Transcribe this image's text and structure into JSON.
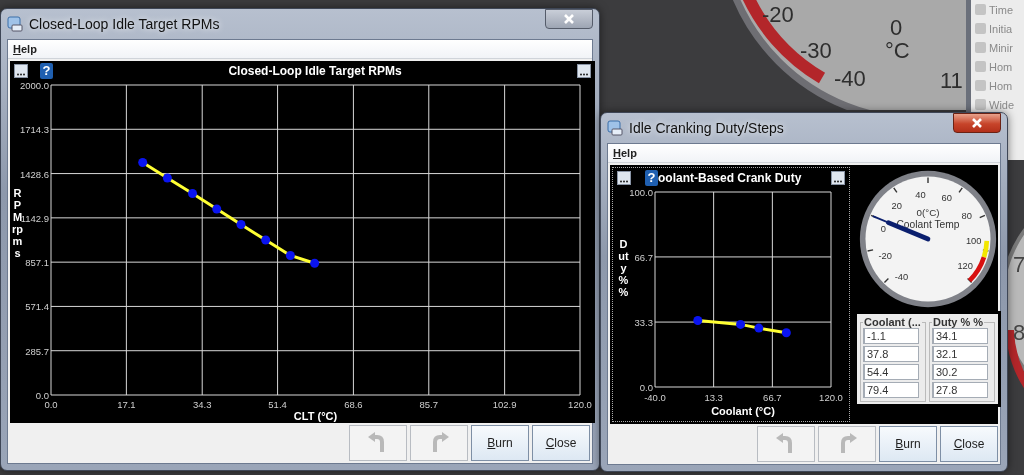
{
  "desktop": {
    "gauge_labels": [
      "-20",
      "-30",
      "-40",
      "0",
      "°C",
      "11"
    ],
    "side_list": [
      "Time",
      "Initia",
      "Minir",
      "Hom",
      "Hom",
      "Wide"
    ],
    "edge_labels": [
      "7",
      "8"
    ]
  },
  "windows": [
    {
      "kind": "curve",
      "title": "Closed-Loop Idle Target RPMs",
      "active": false,
      "menu": [
        "Help"
      ],
      "help_badge": "?",
      "chart_data": {
        "type": "line",
        "title": "Closed-Loop Idle Target RPMs",
        "xlabel": "CLT (°C)",
        "ylabel": "RPM rpms",
        "x": [
          20.8,
          26.4,
          32.1,
          37.6,
          43.1,
          48.7,
          54.3,
          59.8
        ],
        "series": [
          {
            "color": "#ffff33",
            "marker": "circle",
            "values": [
              1500,
              1400,
              1300,
              1200,
              1100,
              1000,
              900,
              850
            ]
          }
        ],
        "xlim": [
          0,
          120
        ],
        "ylim": [
          0,
          2000
        ],
        "grid": true,
        "xticks": [
          {
            "value": 0,
            "label": "0.0"
          },
          17.1,
          34.3,
          51.4,
          68.6,
          85.7,
          102.9,
          {
            "value": 120,
            "label": "120.0"
          }
        ],
        "yticks": [
          {
            "value": 0,
            "label": "0.0"
          },
          285.7,
          571.4,
          857.1,
          1142.9,
          1428.6,
          1714.3,
          {
            "value": 2000,
            "label": "2000.0"
          }
        ]
      },
      "buttons": [
        {
          "kind": "undo",
          "disabled": true
        },
        {
          "kind": "redo",
          "disabled": true
        },
        {
          "kind": "text",
          "label": "Burn"
        },
        {
          "kind": "text",
          "label": "Close"
        }
      ]
    },
    {
      "kind": "curve_gauge",
      "title": "Idle Cranking Duty/Steps",
      "active": true,
      "menu": [
        "Help"
      ],
      "help_badge": "?",
      "chart_data": {
        "type": "line",
        "title": "oolant-Based Crank Duty",
        "xlabel": "Coolant (°C)",
        "ylabel": "Duty % %",
        "x": [
          -1.1,
          37.8,
          54.4,
          79.4
        ],
        "series": [
          {
            "color": "#ffff33",
            "marker": "circle",
            "values": [
              34.1,
              32.1,
              30.2,
              27.8
            ]
          }
        ],
        "xlim": [
          -40,
          120
        ],
        "ylim": [
          0,
          100
        ],
        "grid": true,
        "xticks": [
          {
            "value": -40,
            "label": "-40.0"
          },
          13.3,
          66.7,
          {
            "value": 120,
            "label": "120.0"
          }
        ],
        "yticks": [
          {
            "value": 0,
            "label": "0.0"
          },
          33.3,
          66.7,
          {
            "value": 100,
            "label": "100.0"
          }
        ]
      },
      "gauge": {
        "reading": "0(°C)",
        "title": "Coolant Temp",
        "labels": [
          "-40",
          "-20",
          "0",
          "20",
          "40",
          "60",
          "80",
          "100",
          "120"
        ],
        "level": 0.25
      },
      "table": {
        "columns": [
          {
            "header": "Coolant (...",
            "cells": [
              "-1.1",
              "37.8",
              "54.4",
              "79.4"
            ]
          },
          {
            "header": "Duty % %",
            "cells": [
              "34.1",
              "32.1",
              "30.2",
              "27.8"
            ]
          }
        ]
      },
      "buttons": [
        {
          "kind": "undo",
          "disabled": true
        },
        {
          "kind": "redo",
          "disabled": true
        },
        {
          "kind": "text",
          "label": "Burn"
        },
        {
          "kind": "text",
          "label": "Close"
        }
      ]
    }
  ]
}
